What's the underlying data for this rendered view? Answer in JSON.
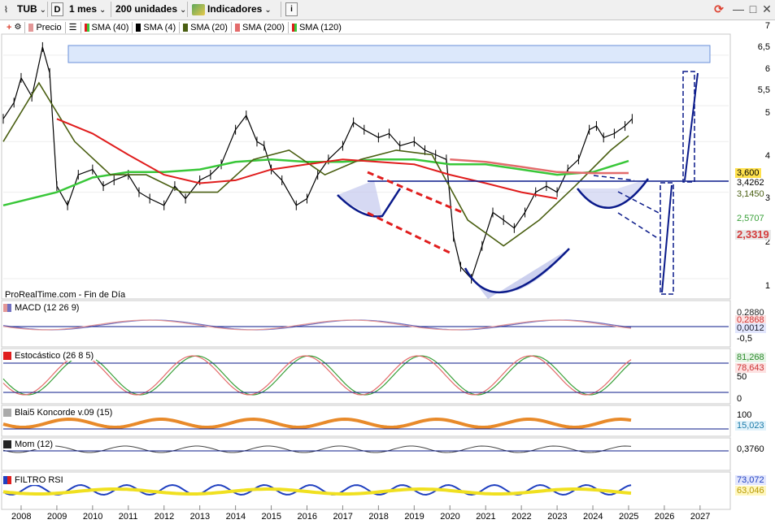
{
  "toolbar": {
    "symbol": "TUB",
    "timeframe_box": "D",
    "period": "1 mes",
    "units": "200 unidades",
    "indicators": "Indicadores",
    "info": "i",
    "minimize": "—",
    "restore": "□",
    "close": "✕"
  },
  "legend": [
    {
      "label": "Precio",
      "color": "#e39797"
    },
    {
      "label": "SMA (40)",
      "color": "#39c739"
    },
    {
      "label": "SMA (4)",
      "color": "#000000"
    },
    {
      "label": "SMA (20)",
      "color": "#4a5f12"
    },
    {
      "label": "SMA (200)",
      "color": "#e36b6b"
    },
    {
      "label": "SMA (120)",
      "color": "#e01d1d"
    }
  ],
  "source_label": "ProRealTime.com - Fin de Día",
  "panels": {
    "macd": "MACD (12 26 9)",
    "stoch": "Estocástico (26 8 5)",
    "koncorde": "Blai5 Koncorde v.09 (15)",
    "mom": "Mom (12)",
    "rsi": "FILTRO RSI"
  },
  "price_axis_ticks": [
    "7",
    "6,5",
    "6",
    "5,5",
    "5",
    "4",
    "3",
    "2",
    "1"
  ],
  "price_tags": [
    {
      "text": "3,600",
      "bg": "#ffe14d",
      "fg": "#000000"
    },
    {
      "text": "3,4262",
      "bg": "#ffffff",
      "fg": "#000000"
    },
    {
      "text": "3,1450",
      "bg": "#ffffff",
      "fg": "#4a5f12"
    },
    {
      "text": "2,5707",
      "bg": "#ffffff",
      "fg": "#39a039"
    },
    {
      "text": "2,3319",
      "bg": "#e8e8e8",
      "fg": "#d43c3c"
    }
  ],
  "macd_axis": {
    "tags": [
      "0,2880",
      "0,2868",
      "0,0012"
    ],
    "ticks": [
      "-0,5"
    ]
  },
  "stoch_axis": {
    "tags": [
      "81,268",
      "78,643"
    ],
    "ticks": [
      "50",
      "0"
    ]
  },
  "koncorde_axis": {
    "ticks": [
      "100"
    ],
    "tags": [
      "15,023"
    ]
  },
  "mom_axis": {
    "tags": [
      "0,3760"
    ]
  },
  "rsi_axis": {
    "tags": [
      "73,072",
      "63,046"
    ]
  },
  "colors": {
    "price": "#000000",
    "sma40": "#39c739",
    "sma20": "#4a5f12",
    "sma200": "#e36b6b",
    "sma120": "#e01d1d",
    "pattern": "#0a1a8a",
    "dashed_red": "#e01d1d",
    "cup_fill": "#b8bde8",
    "zone_fill": "#dce8fb"
  },
  "chart_data": {
    "type": "line",
    "title": "",
    "x": [
      2008,
      2009,
      2010,
      2011,
      2012,
      2013,
      2014,
      2015,
      2016,
      2017,
      2018,
      2019,
      2020,
      2021,
      2022,
      2023,
      2024,
      2025,
      2026,
      2027
    ],
    "xlim": [
      2007.5,
      2027.8
    ],
    "ylim": [
      0.85,
      7.1
    ],
    "yscale": "log",
    "reference_level": 3.4262,
    "series": [
      {
        "name": "Precio",
        "x": [
          2007.5,
          2007.8,
          2008.0,
          2008.3,
          2008.6,
          2008.8,
          2009.0,
          2009.3,
          2009.6,
          2010.0,
          2010.3,
          2010.6,
          2011.0,
          2011.3,
          2011.6,
          2012.0,
          2012.3,
          2012.6,
          2013.0,
          2013.3,
          2013.6,
          2014.0,
          2014.3,
          2014.6,
          2014.8,
          2015.0,
          2015.3,
          2015.7,
          2016.0,
          2016.3,
          2016.6,
          2017.0,
          2017.3,
          2017.6,
          2018.0,
          2018.3,
          2018.6,
          2019.0,
          2019.3,
          2019.6,
          2019.9,
          2020.1,
          2020.3,
          2020.6,
          2020.9,
          2021.2,
          2021.5,
          2021.8,
          2022.1,
          2022.4,
          2022.7,
          2023.0,
          2023.3,
          2023.6,
          2023.9,
          2024.1,
          2024.3,
          2024.6,
          2024.9,
          2025.1
        ],
        "values": [
          3.6,
          4.1,
          5.0,
          4.3,
          6.4,
          5.2,
          2.1,
          1.8,
          2.3,
          2.4,
          2.1,
          2.2,
          2.3,
          2.0,
          1.9,
          1.8,
          2.1,
          1.9,
          2.2,
          2.3,
          2.5,
          3.3,
          3.7,
          3.0,
          2.9,
          2.4,
          2.2,
          1.8,
          1.9,
          2.3,
          2.6,
          2.9,
          3.5,
          3.3,
          3.1,
          3.2,
          2.9,
          3.0,
          2.8,
          2.7,
          2.6,
          1.4,
          1.1,
          1.0,
          1.3,
          1.7,
          1.6,
          1.5,
          1.7,
          2.0,
          2.1,
          2.0,
          2.4,
          2.6,
          3.3,
          3.4,
          3.1,
          3.2,
          3.4,
          3.6
        ]
      },
      {
        "name": "SMA (40)",
        "x": [
          2007.5,
          2009.0,
          2010.0,
          2011.0,
          2012.0,
          2013.0,
          2014.0,
          2015.0,
          2016.0,
          2017.0,
          2018.0,
          2019.0,
          2020.0,
          2021.0,
          2022.0,
          2023.0,
          2024.0,
          2025.0
        ],
        "values": [
          1.8,
          2.0,
          2.25,
          2.35,
          2.35,
          2.4,
          2.55,
          2.6,
          2.55,
          2.55,
          2.6,
          2.6,
          2.5,
          2.5,
          2.4,
          2.3,
          2.35,
          2.57
        ]
      },
      {
        "name": "SMA (20)",
        "x": [
          2007.5,
          2008.5,
          2009.5,
          2010.5,
          2011.5,
          2012.5,
          2013.5,
          2014.5,
          2015.5,
          2016.5,
          2017.5,
          2018.5,
          2019.5,
          2020.5,
          2021.5,
          2022.5,
          2023.5,
          2024.5,
          2025.0
        ],
        "values": [
          3.0,
          4.8,
          3.0,
          2.3,
          2.3,
          2.0,
          2.0,
          2.6,
          2.8,
          2.3,
          2.6,
          2.8,
          2.7,
          1.6,
          1.3,
          1.6,
          2.1,
          2.8,
          3.145
        ]
      },
      {
        "name": "SMA (120)",
        "x": [
          2009.0,
          2010.0,
          2011.0,
          2012.0,
          2013.0,
          2014.0,
          2015.0,
          2016.0,
          2017.0,
          2018.0,
          2019.0,
          2020.0,
          2021.0,
          2022.0,
          2023.0
        ],
        "values": [
          3.6,
          3.2,
          2.7,
          2.3,
          2.15,
          2.2,
          2.4,
          2.5,
          2.6,
          2.55,
          2.5,
          2.3,
          2.15,
          2.0,
          1.9
        ]
      },
      {
        "name": "SMA (200)",
        "x": [
          2020.0,
          2021.0,
          2022.0,
          2023.0,
          2024.0,
          2025.0
        ],
        "values": [
          2.6,
          2.55,
          2.45,
          2.35,
          2.33,
          2.3319
        ]
      }
    ]
  }
}
